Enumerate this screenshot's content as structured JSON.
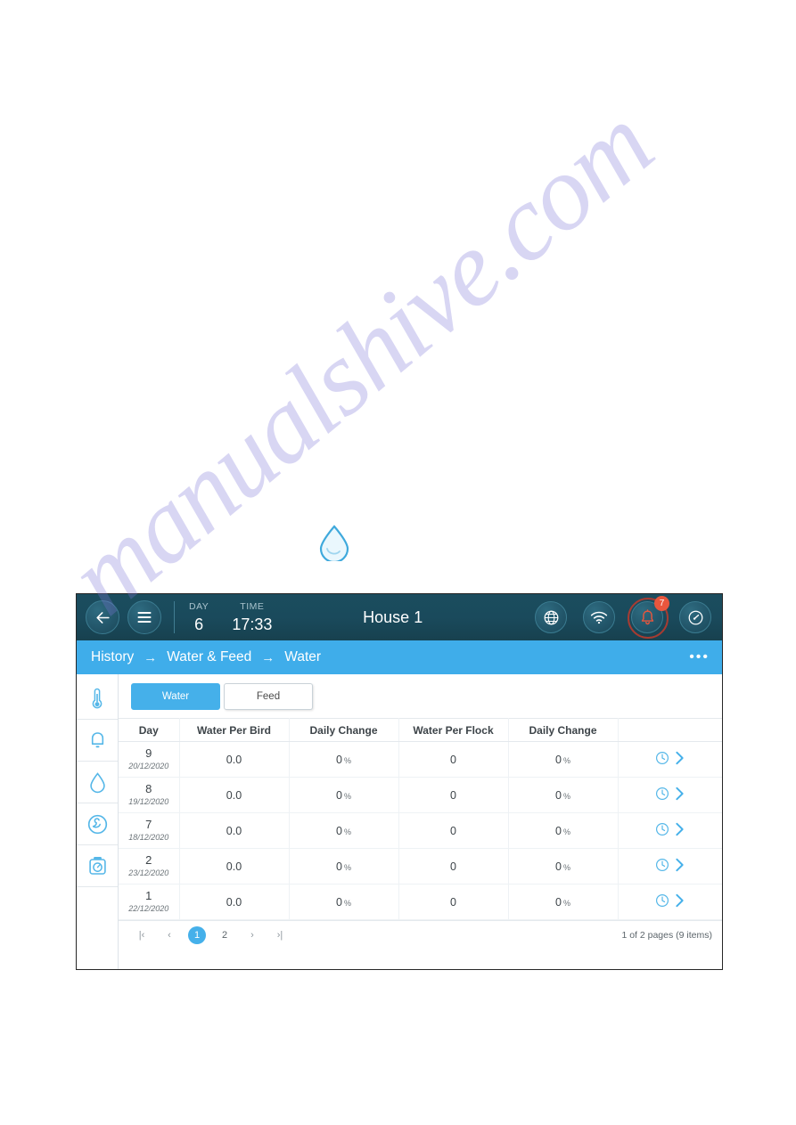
{
  "watermark": {
    "text": "manualshive.com"
  },
  "logo": {
    "name": "water-drop-logo"
  },
  "topbar": {
    "back_icon": "arrow-left-icon",
    "menu_icon": "hamburger-menu-icon",
    "day_label": "DAY",
    "day_value": "6",
    "time_label": "TIME",
    "time_value": "17:33",
    "house_title": "House 1",
    "globe_icon": "globe-icon",
    "wifi_icon": "wifi-icon",
    "bell_icon": "bell-icon",
    "alarm_count": "7",
    "gauge_icon": "gauge-icon"
  },
  "breadcrumb": {
    "items": [
      "History",
      "Water & Feed",
      "Water"
    ],
    "separator": "→",
    "kebab": "•••"
  },
  "rail": {
    "items": [
      {
        "name": "sidebar-item-temperature",
        "icon": "thermometer-icon"
      },
      {
        "name": "sidebar-item-alarms",
        "icon": "bell-icon"
      },
      {
        "name": "sidebar-item-water",
        "icon": "water-drop-icon"
      },
      {
        "name": "sidebar-item-flock",
        "icon": "bird-circle-icon"
      },
      {
        "name": "sidebar-item-weight",
        "icon": "scale-icon"
      }
    ]
  },
  "tabs": [
    {
      "label": "Water",
      "active": true
    },
    {
      "label": "Feed",
      "active": false
    }
  ],
  "table": {
    "headers": [
      "Day",
      "Water Per Bird",
      "Daily Change",
      "Water Per Flock",
      "Daily Change",
      ""
    ],
    "rows": [
      {
        "day": "9",
        "date": "20/12/2020",
        "water_per_bird": "0.0",
        "daily_change_1": "0",
        "pct1": "%",
        "water_per_flock": "0",
        "daily_change_2": "0",
        "pct2": "%"
      },
      {
        "day": "8",
        "date": "19/12/2020",
        "water_per_bird": "0.0",
        "daily_change_1": "0",
        "pct1": "%",
        "water_per_flock": "0",
        "daily_change_2": "0",
        "pct2": "%"
      },
      {
        "day": "7",
        "date": "18/12/2020",
        "water_per_bird": "0.0",
        "daily_change_1": "0",
        "pct1": "%",
        "water_per_flock": "0",
        "daily_change_2": "0",
        "pct2": "%"
      },
      {
        "day": "2",
        "date": "23/12/2020",
        "water_per_bird": "0.0",
        "daily_change_1": "0",
        "pct1": "%",
        "water_per_flock": "0",
        "daily_change_2": "0",
        "pct2": "%"
      },
      {
        "day": "1",
        "date": "22/12/2020",
        "water_per_bird": "0.0",
        "daily_change_1": "0",
        "pct1": "%",
        "water_per_flock": "0",
        "daily_change_2": "0",
        "pct2": "%"
      }
    ],
    "row_action_icons": [
      "clock-icon",
      "chevron-right-icon"
    ]
  },
  "pagination": {
    "first_label": "|‹",
    "prev_label": "‹",
    "pages": [
      "1",
      "2"
    ],
    "current_page": "1",
    "next_label": "›",
    "last_label": "›|",
    "info": "1 of 2 pages (9 items)"
  },
  "colors": {
    "topbar": "#1a4a5c",
    "breadcrumb": "#3fadea",
    "accent": "#45b0ea",
    "alert": "#e8563d"
  }
}
